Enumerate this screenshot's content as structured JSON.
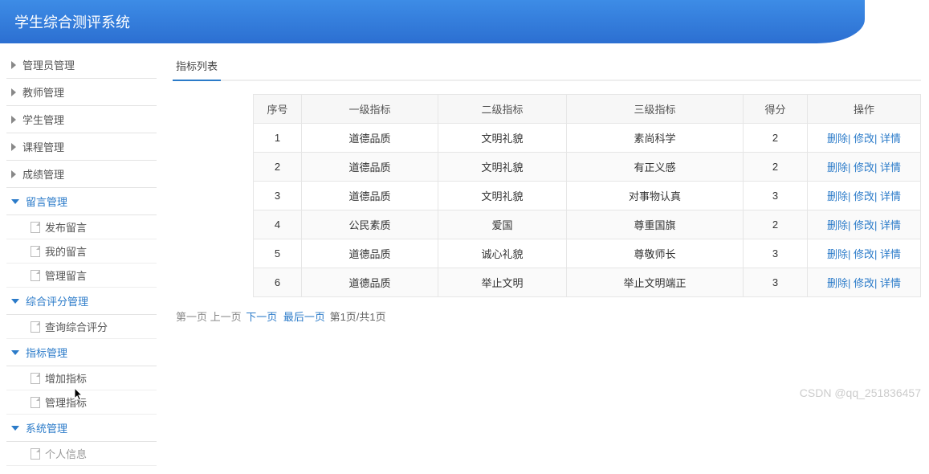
{
  "header": {
    "title": "学生综合测评系统"
  },
  "sidebar": {
    "groups": [
      {
        "label": "管理员管理",
        "expanded": false,
        "items": []
      },
      {
        "label": "教师管理",
        "expanded": false,
        "items": []
      },
      {
        "label": "学生管理",
        "expanded": false,
        "items": []
      },
      {
        "label": "课程管理",
        "expanded": false,
        "items": []
      },
      {
        "label": "成绩管理",
        "expanded": false,
        "items": []
      },
      {
        "label": "留言管理",
        "expanded": true,
        "items": [
          {
            "label": "发布留言",
            "active": false
          },
          {
            "label": "我的留言",
            "active": false
          },
          {
            "label": "管理留言",
            "active": false
          }
        ]
      },
      {
        "label": "综合评分管理",
        "expanded": true,
        "items": [
          {
            "label": "查询综合评分",
            "active": false
          }
        ]
      },
      {
        "label": "指标管理",
        "expanded": true,
        "items": [
          {
            "label": "增加指标",
            "active": false
          },
          {
            "label": "管理指标",
            "active": false
          }
        ]
      },
      {
        "label": "系统管理",
        "expanded": true,
        "items": [
          {
            "label": "个人信息",
            "active": true
          }
        ]
      }
    ]
  },
  "main": {
    "title": "指标列表",
    "table": {
      "headers": [
        "序号",
        "一级指标",
        "二级指标",
        "三级指标",
        "得分",
        "操作"
      ],
      "rows": [
        {
          "seq": "1",
          "l1": "道德品质",
          "l2": "文明礼貌",
          "l3": "素尚科学",
          "score": "2"
        },
        {
          "seq": "2",
          "l1": "道德品质",
          "l2": "文明礼貌",
          "l3": "有正义感",
          "score": "2"
        },
        {
          "seq": "3",
          "l1": "道德品质",
          "l2": "文明礼貌",
          "l3": "对事物认真",
          "score": "3"
        },
        {
          "seq": "4",
          "l1": "公民素质",
          "l2": "爱国",
          "l3": "尊重国旗",
          "score": "2"
        },
        {
          "seq": "5",
          "l1": "道德品质",
          "l2": "诚心礼貌",
          "l3": "尊敬师长",
          "score": "3"
        },
        {
          "seq": "6",
          "l1": "道德品质",
          "l2": "举止文明",
          "l3": "举止文明端正",
          "score": "3"
        }
      ],
      "actions": {
        "delete": "删除",
        "edit": "修改",
        "detail": "详情"
      }
    },
    "pagination": {
      "first": "第一页",
      "prev": "上一页",
      "next": "下一页",
      "last": "最后一页",
      "info": "第1页/共1页"
    }
  },
  "watermark": "CSDN @qq_251836457"
}
